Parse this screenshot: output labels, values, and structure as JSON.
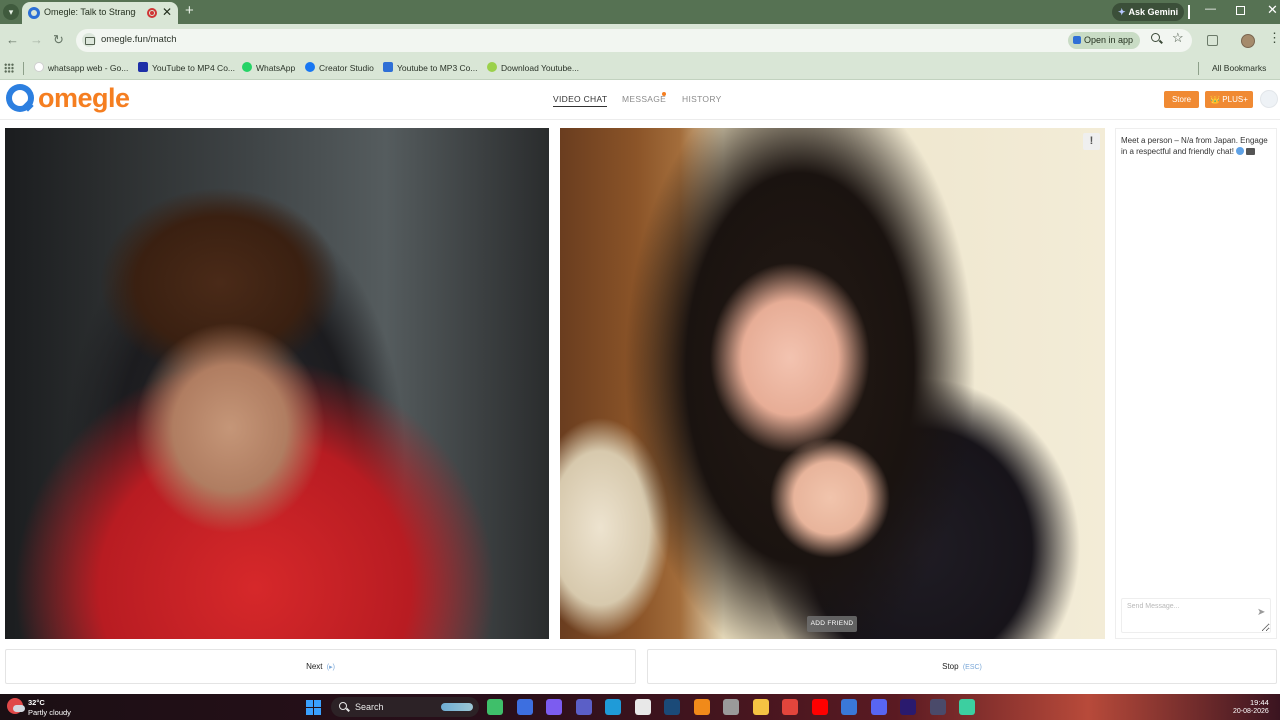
{
  "browser": {
    "tab_title": "Omegle: Talk to Strangers!",
    "tab_close": "✕",
    "new_tab": "+",
    "url": "omegle.fun/match",
    "open_in_app": "Open in app",
    "ask_gemini": "Ask Gemini",
    "bookmarks": [
      {
        "label": "whatsapp web - Go...",
        "icon_color": "#ffffff"
      },
      {
        "label": "YouTube to MP4 Co...",
        "icon_color": "#1d2fa8"
      },
      {
        "label": "WhatsApp",
        "icon_color": "#25d366"
      },
      {
        "label": "Creator Studio",
        "icon_color": "#1877f2"
      },
      {
        "label": "Youtube to MP3 Co...",
        "icon_color": "#2e6fd6"
      },
      {
        "label": "Download Youtube...",
        "icon_color": "#9bd14b"
      }
    ],
    "all_bookmarks": "All Bookmarks"
  },
  "site": {
    "logo": "omegle",
    "nav": {
      "video_chat": "VIDEO CHAT",
      "message": "MESSAGE",
      "history": "HISTORY"
    },
    "store_button": "Store",
    "plus_button": "👑 PLUS+",
    "accent_color": "#f57e20"
  },
  "video": {
    "report_button": "!",
    "add_friend": "ADD FRIEND"
  },
  "chat": {
    "intro": "Meet a person – N/a from Japan. Engage in a respectful and friendly chat!",
    "input_placeholder": "Send Message...",
    "send_icon": "➤"
  },
  "actions": {
    "next_label": "Next",
    "next_hint": "(▸)",
    "stop_label": "Stop",
    "stop_hint": "(ESC)"
  },
  "taskbar": {
    "temperature": "32°C",
    "weather": "Partly cloudy",
    "search_label": "Search",
    "time": "19:44",
    "date": "20-08-2026",
    "apps": [
      {
        "name": "widgets-app-icon",
        "color": "#3fbf6a"
      },
      {
        "name": "meet-app-icon",
        "color": "#3d6fe0"
      },
      {
        "name": "copilot-app-icon",
        "color": "#7c5cf0"
      },
      {
        "name": "teams-app-icon",
        "color": "#5b5fc7"
      },
      {
        "name": "edge-app-icon",
        "color": "#1f9bd8"
      },
      {
        "name": "store-app-icon",
        "color": "#e8e8e8"
      },
      {
        "name": "steam-app-icon",
        "color": "#1b4a78"
      },
      {
        "name": "vlc-app-icon",
        "color": "#f08a1a"
      },
      {
        "name": "clock-app-icon",
        "color": "#9a9a9a"
      },
      {
        "name": "file-explorer-app-icon",
        "color": "#f5c343"
      },
      {
        "name": "chrome-app-icon",
        "color": "#e2453c"
      },
      {
        "name": "youtube-app-icon",
        "color": "#ff0000"
      },
      {
        "name": "photoshop-app-icon",
        "color": "#3a78d8"
      },
      {
        "name": "discord-app-icon",
        "color": "#5865f2"
      },
      {
        "name": "premiere-app-icon",
        "color": "#2a1a6e"
      },
      {
        "name": "obs-app-icon",
        "color": "#4a4a6a"
      },
      {
        "name": "terminal-app-icon",
        "color": "#3ccfa0"
      }
    ]
  }
}
